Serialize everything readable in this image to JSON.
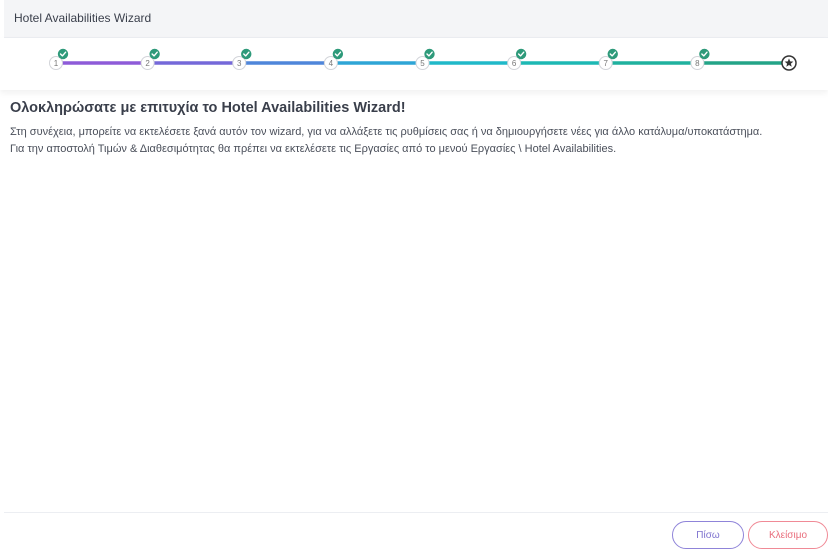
{
  "header": {
    "title": "Hotel Availabilities Wizard"
  },
  "stepper": {
    "steps": [
      {
        "number": "1",
        "completed": true
      },
      {
        "number": "2",
        "completed": true
      },
      {
        "number": "3",
        "completed": true
      },
      {
        "number": "4",
        "completed": true
      },
      {
        "number": "5",
        "completed": true
      },
      {
        "number": "6",
        "completed": true
      },
      {
        "number": "7",
        "completed": true
      },
      {
        "number": "8",
        "completed": true
      },
      {
        "number": "",
        "icon": "star-icon",
        "current": true
      }
    ],
    "colors": [
      "#8e5bd8",
      "#7568d9",
      "#4f86da",
      "#2ea5d6",
      "#20b9c9",
      "#1db8b4",
      "#1fb19e",
      "#23a487"
    ],
    "check_color": "#2e9a7a"
  },
  "content": {
    "title": "Ολοκληρώσατε με επιτυχία το Hotel Availabilities Wizard!",
    "paragraph1": "Στη συνέχεια, μπορείτε να εκτελέσετε ξανά αυτόν τον wizard, για να αλλάξετε τις ρυθμίσεις σας ή να δημιουργήσετε νέες για άλλο κατάλυμα/υποκατάστημα.",
    "paragraph2": "Για την αποστολή Τιμών & Διαθεσιμότητας θα πρέπει να εκτελέσετε τις Εργασίες από το μενού Εργασίες \\ Hotel Availabilities."
  },
  "footer": {
    "back_label": "Πίσω",
    "close_label": "Κλείσιμο"
  }
}
